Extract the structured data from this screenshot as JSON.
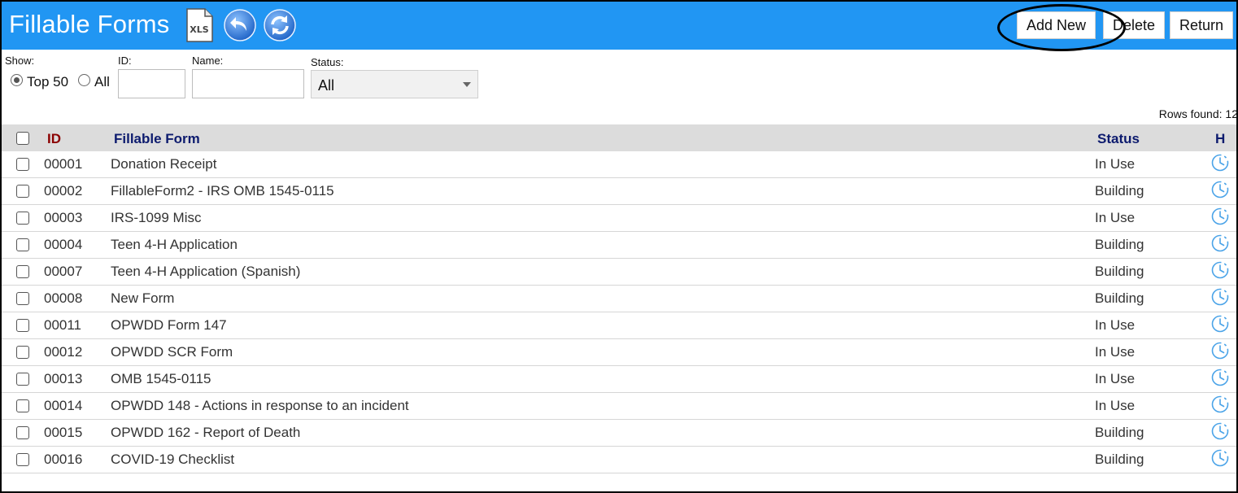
{
  "header": {
    "title": "Fillable Forms",
    "xls_label": "XLS",
    "add_new_label": "Add New",
    "delete_label": "Delete",
    "return_label": "Return",
    "bar_color": "#2196f3"
  },
  "filters": {
    "show_label": "Show:",
    "show_options": [
      "Top 50",
      "All"
    ],
    "show_selected": "Top 50",
    "id_label": "ID:",
    "id_value": "",
    "name_label": "Name:",
    "name_value": "",
    "status_label": "Status:",
    "status_value": "All"
  },
  "rows_found_text": "Rows found: 12",
  "table": {
    "columns": {
      "id": "ID",
      "form": "Fillable Form",
      "status": "Status",
      "history": "H"
    },
    "rows": [
      {
        "id": "00001",
        "form": "Donation Receipt",
        "status": "In Use"
      },
      {
        "id": "00002",
        "form": "FillableForm2 - IRS OMB 1545-0115",
        "status": "Building"
      },
      {
        "id": "00003",
        "form": "IRS-1099 Misc",
        "status": "In Use"
      },
      {
        "id": "00004",
        "form": "Teen 4-H Application",
        "status": "Building"
      },
      {
        "id": "00007",
        "form": "Teen 4-H Application (Spanish)",
        "status": "Building"
      },
      {
        "id": "00008",
        "form": "New Form",
        "status": "Building"
      },
      {
        "id": "00011",
        "form": "OPWDD Form 147",
        "status": "In Use"
      },
      {
        "id": "00012",
        "form": "OPWDD SCR Form",
        "status": "In Use"
      },
      {
        "id": "00013",
        "form": "OMB 1545-0115",
        "status": "In Use"
      },
      {
        "id": "00014",
        "form": "OPWDD 148 - Actions in response to an incident",
        "status": "In Use"
      },
      {
        "id": "00015",
        "form": "OPWDD 162 - Report of Death",
        "status": "Building"
      },
      {
        "id": "00016",
        "form": "COVID-19 Checklist",
        "status": "Building"
      }
    ]
  },
  "icons": {
    "xls": "xls-icon",
    "back": "back-arrow-icon",
    "refresh": "refresh-icon",
    "history": "clock-history-icon"
  }
}
